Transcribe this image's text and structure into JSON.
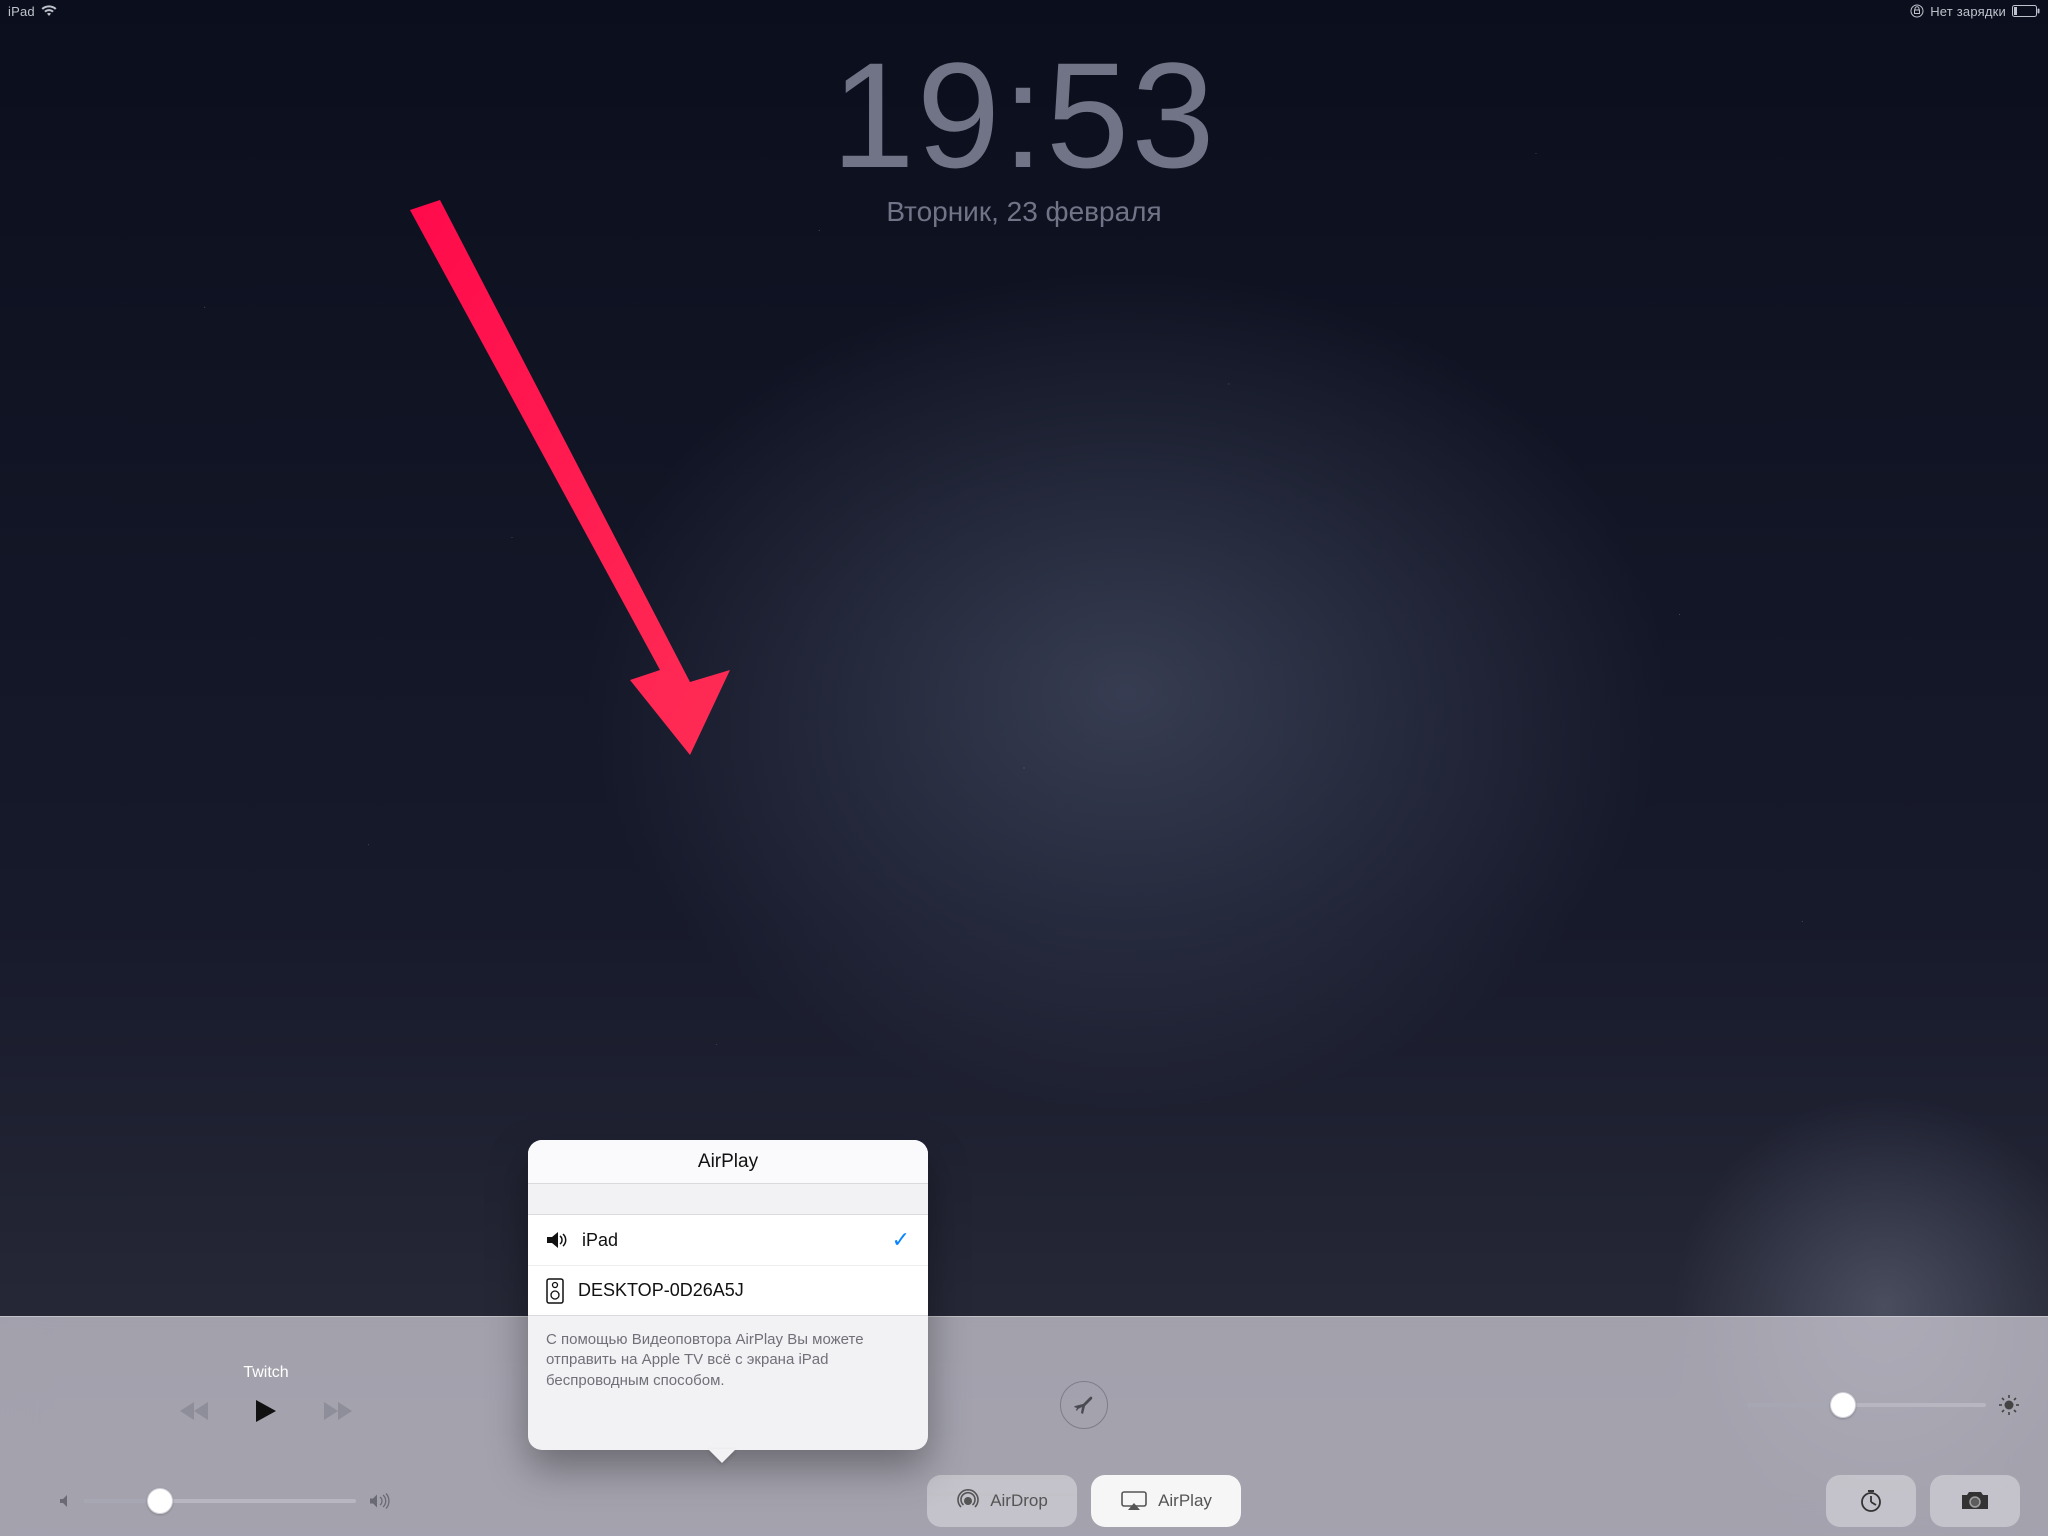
{
  "status": {
    "device": "iPad",
    "charge": "Нет зарядки"
  },
  "lock": {
    "time": "19:53",
    "date": "Вторник, 23 февраля"
  },
  "control_center": {
    "media_title": "Twitch",
    "airdrop_label": "AirDrop",
    "airplay_label": "AirPlay"
  },
  "airplay": {
    "title": "AirPlay",
    "device1": "iPad",
    "device2": "DESKTOP-0D26A5J",
    "footer": "С помощью Видеоповтора AirPlay Вы можете отправить на Apple TV всё с экрана iPad беспроводным способом."
  }
}
